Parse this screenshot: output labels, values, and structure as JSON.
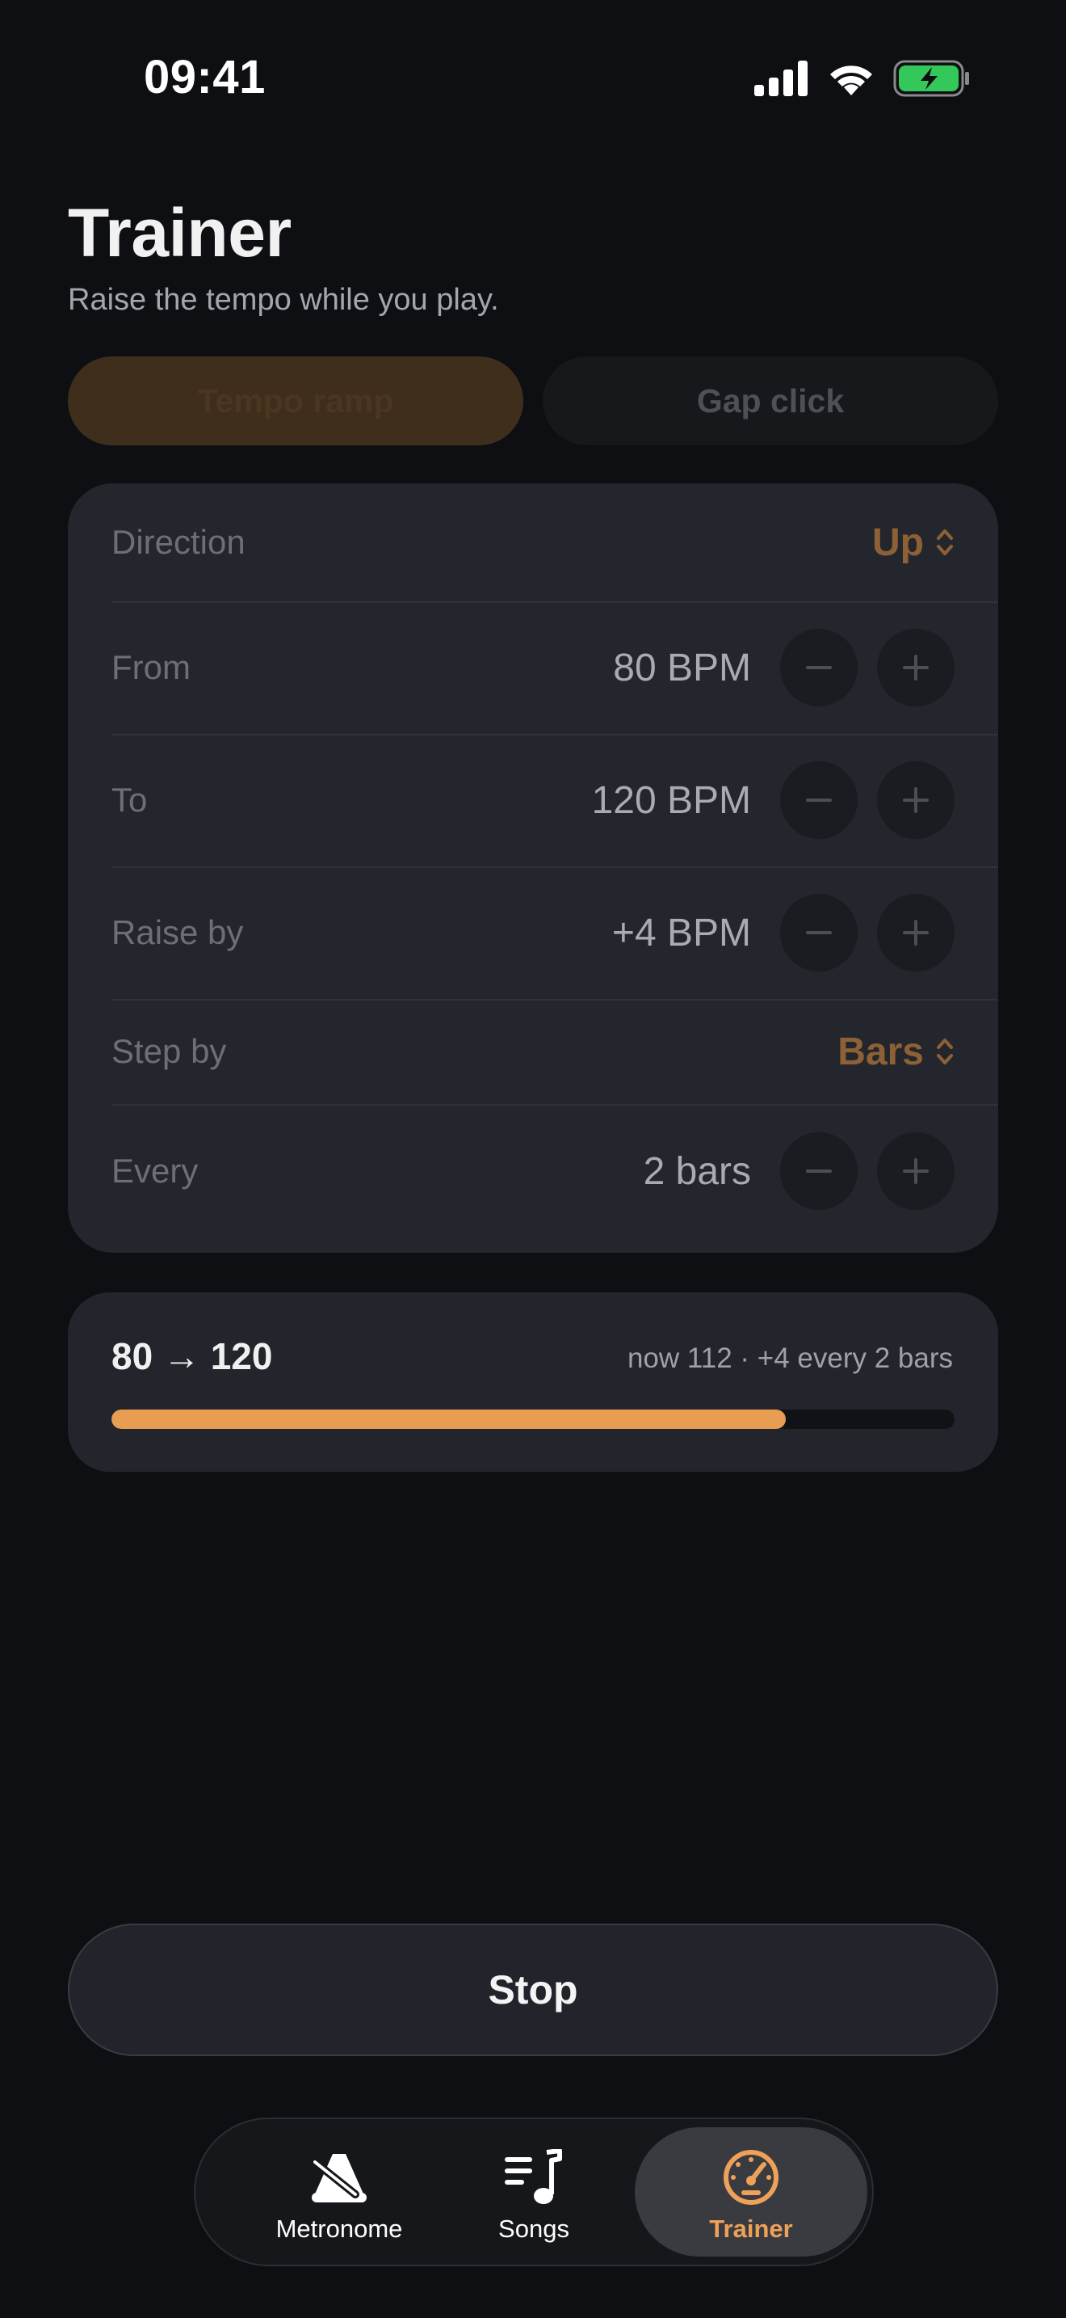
{
  "status_bar": {
    "time": "09:41",
    "icons": [
      "signal-icon",
      "wifi-icon",
      "battery-charging-icon"
    ],
    "battery_color": "#34c759"
  },
  "header": {
    "title": "Trainer",
    "subtitle": "Raise the tempo while you play."
  },
  "mode_tabs": [
    {
      "label": "Tempo ramp",
      "selected": true
    },
    {
      "label": "Gap click",
      "selected": false
    }
  ],
  "settings": {
    "direction": {
      "label": "Direction",
      "value": "Up"
    },
    "from": {
      "label": "From",
      "value": "80 BPM"
    },
    "to": {
      "label": "To",
      "value": "120 BPM"
    },
    "raise_by": {
      "label": "Raise by",
      "value": "+4 BPM"
    },
    "step_by": {
      "label": "Step by",
      "value": "Bars"
    },
    "every": {
      "label": "Every",
      "value": "2 bars"
    }
  },
  "progress": {
    "range": "80 → 120",
    "detail": "now 112 · +4 every 2 bars",
    "fraction": 0.8
  },
  "stop_button": {
    "label": "Stop"
  },
  "tab_bar": {
    "items": [
      {
        "label": "Metronome",
        "icon": "metronome-icon",
        "active": false
      },
      {
        "label": "Songs",
        "icon": "music-list-icon",
        "active": false
      },
      {
        "label": "Trainer",
        "icon": "gauge-icon",
        "active": true
      }
    ]
  },
  "colors": {
    "accent": "#e99d52",
    "background": "#0e0f12",
    "card": "#24262d"
  }
}
